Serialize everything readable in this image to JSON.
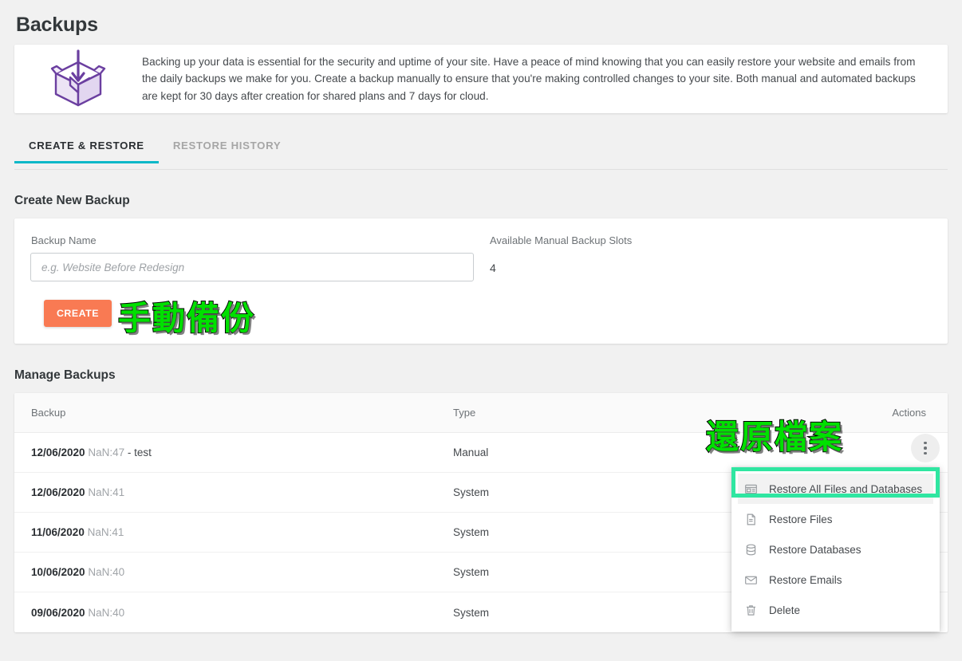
{
  "page": {
    "title": "Backups"
  },
  "info": {
    "icon": "open-box-with-down-arrow-icon",
    "text": "Backing up your data is essential for the security and uptime of your site. Have a peace of mind knowing that you can easily restore your website and emails from the daily backups we make for you. Create a backup manually to ensure that you're making controlled changes to your site. Both manual and automated backups are kept for 30 days after creation for shared plans and 7 days for cloud."
  },
  "tabs": [
    {
      "label": "CREATE & RESTORE",
      "active": true
    },
    {
      "label": "RESTORE HISTORY",
      "active": false
    }
  ],
  "create": {
    "heading": "Create New Backup",
    "name_label": "Backup Name",
    "name_value": "",
    "name_placeholder": "e.g. Website Before Redesign",
    "slots_label": "Available Manual Backup Slots",
    "slots_value": "4",
    "create_button": "CREATE"
  },
  "manage": {
    "heading": "Manage Backups",
    "columns": [
      "Backup",
      "Type",
      "Actions"
    ],
    "rows": [
      {
        "date": "12/06/2020",
        "time": "NaN:47",
        "note": " - test",
        "type": "Manual"
      },
      {
        "date": "12/06/2020",
        "time": "NaN:41",
        "note": "",
        "type": "System"
      },
      {
        "date": "11/06/2020",
        "time": "NaN:41",
        "note": "",
        "type": "System"
      },
      {
        "date": "10/06/2020",
        "time": "NaN:40",
        "note": "",
        "type": "System"
      },
      {
        "date": "09/06/2020",
        "time": "NaN:40",
        "note": "",
        "type": "System"
      }
    ]
  },
  "menu": {
    "items": [
      {
        "label": "Restore All Files and Databases",
        "icon": "restore-all-icon",
        "highlighted": true
      },
      {
        "label": "Restore Files",
        "icon": "file-icon",
        "highlighted": false
      },
      {
        "label": "Restore Databases",
        "icon": "database-icon",
        "highlighted": false
      },
      {
        "label": "Restore Emails",
        "icon": "envelope-icon",
        "highlighted": false
      },
      {
        "label": "Delete",
        "icon": "trash-icon",
        "highlighted": false
      }
    ]
  },
  "annotations": [
    {
      "text": "手動備份",
      "color": "#00e000"
    },
    {
      "text": "還原檔案",
      "color": "#00e000"
    }
  ],
  "colors": {
    "accent_tab": "#0bb8c8",
    "create_button": "#f97a53",
    "annotation_green": "#00e000",
    "highlight_box": "#2fe6a1",
    "icon_purple": "#6b3fa0"
  }
}
